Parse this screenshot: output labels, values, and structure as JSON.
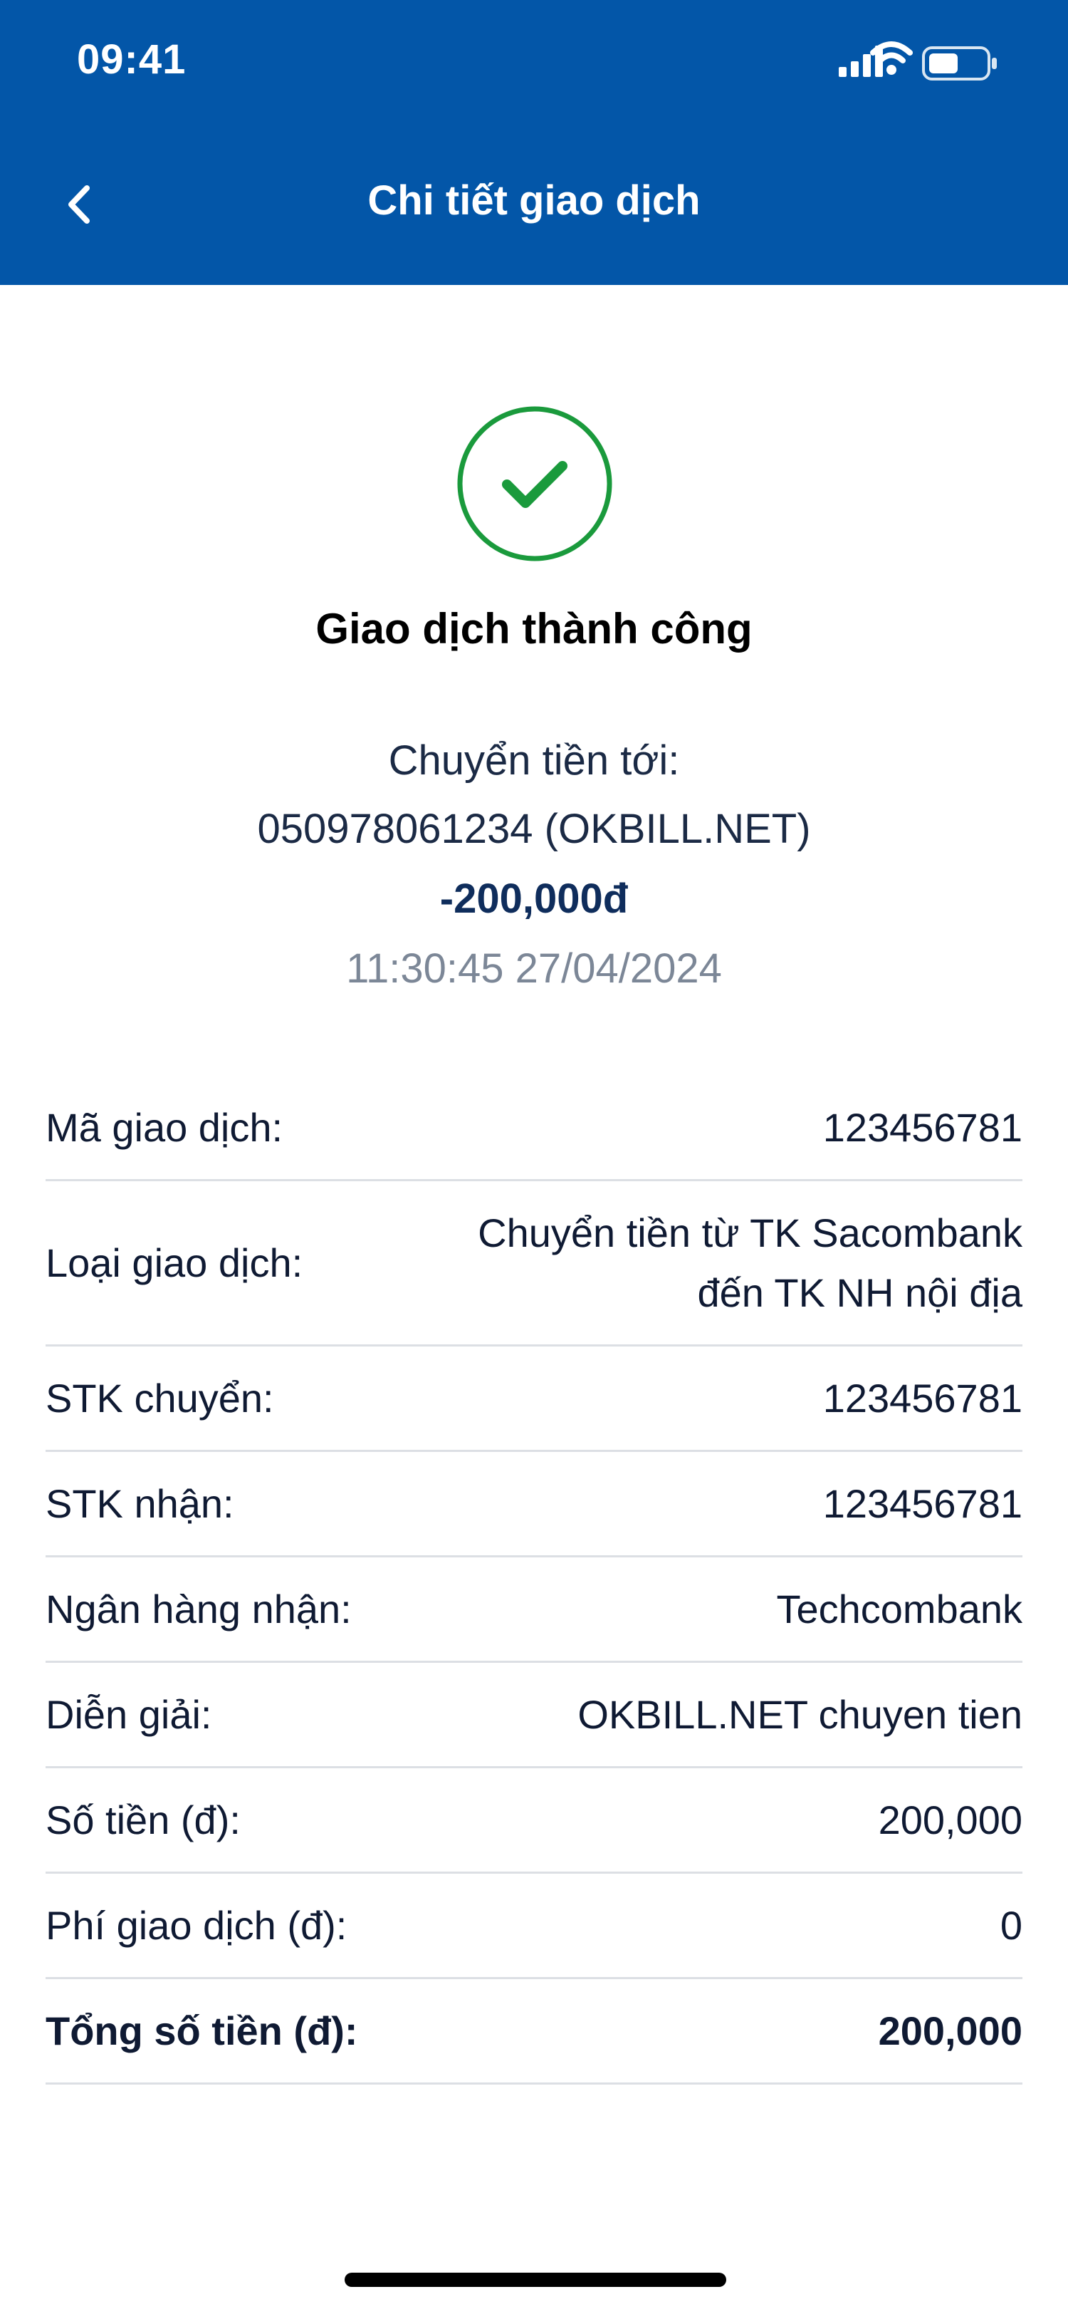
{
  "status_bar": {
    "time": "09:41"
  },
  "header": {
    "title": "Chi tiết giao dịch"
  },
  "result": {
    "title": "Giao dịch thành công",
    "transfer_label": "Chuyển tiền tới:",
    "recipient": "050978061234 (OKBILL.NET)",
    "amount": "-200,000đ",
    "datetime": "11:30:45 27/04/2024"
  },
  "details": [
    {
      "label": "Mã giao dịch:",
      "value": "123456781"
    },
    {
      "label": "Loại giao dịch:",
      "value_line1": "Chuyển tiền từ TK Sacombank",
      "value_line2": "đến TK NH nội địa"
    },
    {
      "label": "STK chuyển:",
      "value": "123456781"
    },
    {
      "label": "STK nhận:",
      "value": "123456781"
    },
    {
      "label": "Ngân hàng nhận:",
      "value": "Techcombank"
    },
    {
      "label": "Diễn giải:",
      "value": "OKBILL.NET chuyen tien"
    },
    {
      "label": "Số tiền (đ):",
      "value": "200,000"
    },
    {
      "label": "Phí giao dịch (đ):",
      "value": "0"
    },
    {
      "label": "Tổng số tiền (đ):",
      "value": "200,000"
    }
  ],
  "icons": {
    "back": "chevron-left-icon",
    "success": "check-circle-icon",
    "signal": "cellular-signal-icon",
    "wifi": "wifi-icon",
    "battery": "battery-icon"
  },
  "colors": {
    "header_bg": "#0356a8",
    "success_green": "#1a9a3c",
    "amount_text": "#0f2d5c",
    "muted_text": "#7c8797",
    "divider": "#dcdfe4"
  }
}
